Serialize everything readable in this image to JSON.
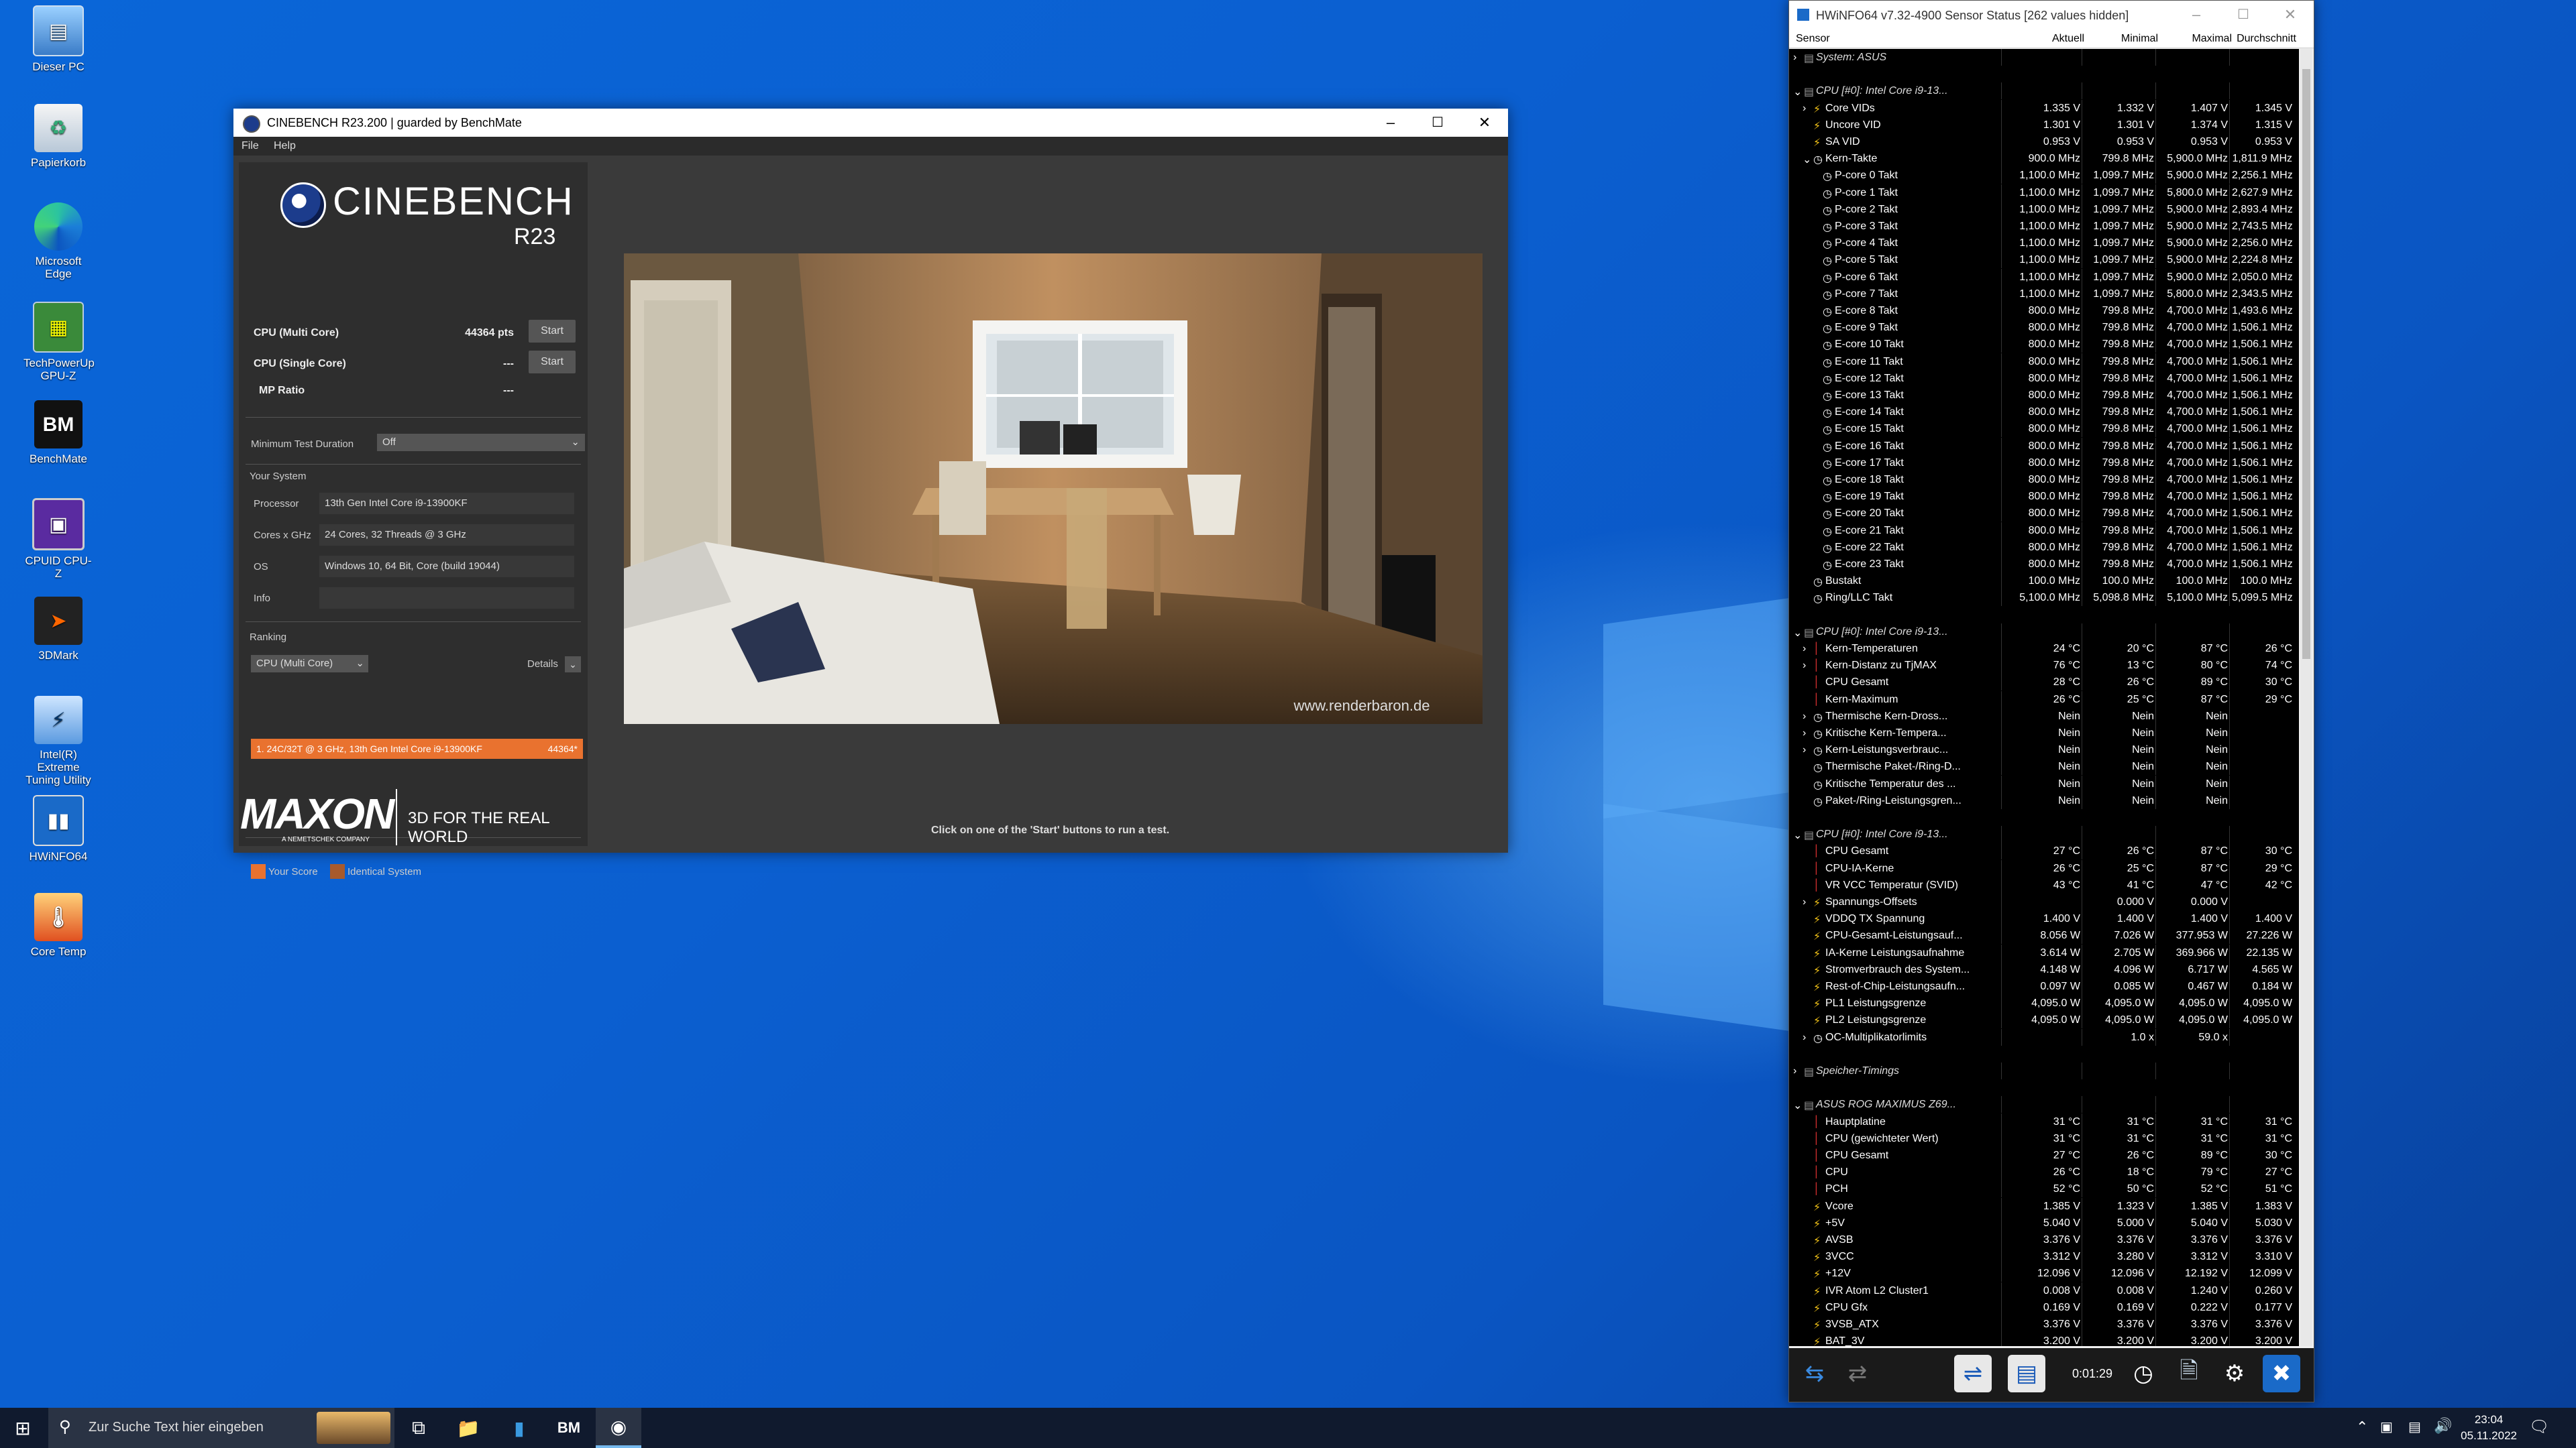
{
  "desktop": {
    "icons": [
      {
        "label": "Dieser PC",
        "icon": "computer-icon"
      },
      {
        "label": "Papierkorb",
        "icon": "recycle-bin-icon"
      },
      {
        "label": "Microsoft Edge",
        "icon": "edge-icon"
      },
      {
        "label": "TechPowerUp GPU-Z",
        "icon": "gpuz-icon"
      },
      {
        "label": "BenchMate",
        "icon": "benchmate-icon"
      },
      {
        "label": "CPUID CPU-Z",
        "icon": "cpuz-icon"
      },
      {
        "label": "3DMark",
        "icon": "3dmark-icon"
      },
      {
        "label": "Intel(R) Extreme Tuning Utility",
        "icon": "xtu-icon"
      },
      {
        "label": "HWiNFO64",
        "icon": "hwinfo-icon"
      },
      {
        "label": "Core Temp",
        "icon": "coretemp-icon"
      }
    ]
  },
  "cinebench": {
    "window_title": "CINEBENCH R23.200 | guarded by BenchMate",
    "menu": [
      "File",
      "Help"
    ],
    "logo_text": "CINEBENCH",
    "logo_version": "R23",
    "tests": [
      {
        "label": "CPU (Multi Core)",
        "value": "44364 pts",
        "button": "Start"
      },
      {
        "label": "CPU (Single Core)",
        "value": "---",
        "button": "Start"
      },
      {
        "label": "MP Ratio",
        "value": "---"
      }
    ],
    "min_duration_label": "Minimum Test Duration",
    "min_duration_value": "Off",
    "your_system_label": "Your System",
    "system": [
      {
        "label": "Processor",
        "value": "13th Gen Intel Core i9-13900KF"
      },
      {
        "label": "Cores x GHz",
        "value": "24 Cores, 32 Threads @ 3 GHz"
      },
      {
        "label": "OS",
        "value": "Windows 10, 64 Bit, Core (build 19044)"
      },
      {
        "label": "Info",
        "value": ""
      }
    ],
    "ranking_label": "Ranking",
    "ranking_select": "CPU (Multi Core)",
    "details_label": "Details",
    "rank_entry": "1. 24C/32T @ 3 GHz, 13th Gen Intel Core i9-13900KF",
    "rank_score": "44364*",
    "legend_your": "Your Score",
    "legend_identical": "Identical System",
    "maxon_text": "MAXON",
    "maxon_sub": "A NEMETSCHEK COMPANY",
    "tagline": "3D FOR THE REAL WORLD",
    "status": "Click on one of the 'Start' buttons to run a test.",
    "watermark": "www.renderbaron.de",
    "colors": {
      "accent": "#e9722f",
      "identical": "#a85a2c"
    }
  },
  "hwinfo": {
    "window_title": "HWiNFO64 v7.32-4900 Sensor Status [262 values hidden]",
    "columns": [
      "Sensor",
      "Aktuell",
      "Minimal",
      "Maximal",
      "Durchschnitt"
    ],
    "time": "0:01:29",
    "rows": [
      {
        "t": "group",
        "name": "System: ASUS",
        "exp": ">"
      },
      {
        "t": "spacer"
      },
      {
        "t": "group",
        "name": "CPU [#0]: Intel Core i9-13...",
        "exp": "v"
      },
      {
        "t": "row",
        "name": "Core VIDs",
        "exp": ">",
        "icon": "bolt",
        "v": [
          "1.335 V",
          "1.332 V",
          "1.407 V",
          "1.345 V"
        ]
      },
      {
        "t": "row",
        "name": "Uncore VID",
        "icon": "bolt",
        "v": [
          "1.301 V",
          "1.301 V",
          "1.374 V",
          "1.315 V"
        ]
      },
      {
        "t": "row",
        "name": "SA VID",
        "icon": "bolt",
        "v": [
          "0.953 V",
          "0.953 V",
          "0.953 V",
          "0.953 V"
        ]
      },
      {
        "t": "row",
        "name": "Kern-Takte",
        "exp": "v",
        "icon": "clock",
        "v": [
          "900.0 MHz",
          "799.8 MHz",
          "5,900.0 MHz",
          "1,811.9 MHz"
        ]
      },
      {
        "t": "row",
        "name": "P-core 0 Takt",
        "icon": "clock",
        "sub": 1,
        "v": [
          "1,100.0 MHz",
          "1,099.7 MHz",
          "5,900.0 MHz",
          "2,256.1 MHz"
        ]
      },
      {
        "t": "row",
        "name": "P-core 1 Takt",
        "icon": "clock",
        "sub": 1,
        "v": [
          "1,100.0 MHz",
          "1,099.7 MHz",
          "5,800.0 MHz",
          "2,627.9 MHz"
        ]
      },
      {
        "t": "row",
        "name": "P-core 2 Takt",
        "icon": "clock",
        "sub": 1,
        "v": [
          "1,100.0 MHz",
          "1,099.7 MHz",
          "5,900.0 MHz",
          "2,893.4 MHz"
        ]
      },
      {
        "t": "row",
        "name": "P-core 3 Takt",
        "icon": "clock",
        "sub": 1,
        "v": [
          "1,100.0 MHz",
          "1,099.7 MHz",
          "5,900.0 MHz",
          "2,743.5 MHz"
        ]
      },
      {
        "t": "row",
        "name": "P-core 4 Takt",
        "icon": "clock",
        "sub": 1,
        "v": [
          "1,100.0 MHz",
          "1,099.7 MHz",
          "5,900.0 MHz",
          "2,256.0 MHz"
        ]
      },
      {
        "t": "row",
        "name": "P-core 5 Takt",
        "icon": "clock",
        "sub": 1,
        "v": [
          "1,100.0 MHz",
          "1,099.7 MHz",
          "5,900.0 MHz",
          "2,224.8 MHz"
        ]
      },
      {
        "t": "row",
        "name": "P-core 6 Takt",
        "icon": "clock",
        "sub": 1,
        "v": [
          "1,100.0 MHz",
          "1,099.7 MHz",
          "5,900.0 MHz",
          "2,050.0 MHz"
        ]
      },
      {
        "t": "row",
        "name": "P-core 7 Takt",
        "icon": "clock",
        "sub": 1,
        "v": [
          "1,100.0 MHz",
          "1,099.7 MHz",
          "5,800.0 MHz",
          "2,343.5 MHz"
        ]
      },
      {
        "t": "row",
        "name": "E-core 8 Takt",
        "icon": "clock",
        "sub": 1,
        "v": [
          "800.0 MHz",
          "799.8 MHz",
          "4,700.0 MHz",
          "1,493.6 MHz"
        ]
      },
      {
        "t": "row",
        "name": "E-core 9 Takt",
        "icon": "clock",
        "sub": 1,
        "v": [
          "800.0 MHz",
          "799.8 MHz",
          "4,700.0 MHz",
          "1,506.1 MHz"
        ]
      },
      {
        "t": "row",
        "name": "E-core 10 Takt",
        "icon": "clock",
        "sub": 1,
        "v": [
          "800.0 MHz",
          "799.8 MHz",
          "4,700.0 MHz",
          "1,506.1 MHz"
        ]
      },
      {
        "t": "row",
        "name": "E-core 11 Takt",
        "icon": "clock",
        "sub": 1,
        "v": [
          "800.0 MHz",
          "799.8 MHz",
          "4,700.0 MHz",
          "1,506.1 MHz"
        ]
      },
      {
        "t": "row",
        "name": "E-core 12 Takt",
        "icon": "clock",
        "sub": 1,
        "v": [
          "800.0 MHz",
          "799.8 MHz",
          "4,700.0 MHz",
          "1,506.1 MHz"
        ]
      },
      {
        "t": "row",
        "name": "E-core 13 Takt",
        "icon": "clock",
        "sub": 1,
        "v": [
          "800.0 MHz",
          "799.8 MHz",
          "4,700.0 MHz",
          "1,506.1 MHz"
        ]
      },
      {
        "t": "row",
        "name": "E-core 14 Takt",
        "icon": "clock",
        "sub": 1,
        "v": [
          "800.0 MHz",
          "799.8 MHz",
          "4,700.0 MHz",
          "1,506.1 MHz"
        ]
      },
      {
        "t": "row",
        "name": "E-core 15 Takt",
        "icon": "clock",
        "sub": 1,
        "v": [
          "800.0 MHz",
          "799.8 MHz",
          "4,700.0 MHz",
          "1,506.1 MHz"
        ]
      },
      {
        "t": "row",
        "name": "E-core 16 Takt",
        "icon": "clock",
        "sub": 1,
        "v": [
          "800.0 MHz",
          "799.8 MHz",
          "4,700.0 MHz",
          "1,506.1 MHz"
        ]
      },
      {
        "t": "row",
        "name": "E-core 17 Takt",
        "icon": "clock",
        "sub": 1,
        "v": [
          "800.0 MHz",
          "799.8 MHz",
          "4,700.0 MHz",
          "1,506.1 MHz"
        ]
      },
      {
        "t": "row",
        "name": "E-core 18 Takt",
        "icon": "clock",
        "sub": 1,
        "v": [
          "800.0 MHz",
          "799.8 MHz",
          "4,700.0 MHz",
          "1,506.1 MHz"
        ]
      },
      {
        "t": "row",
        "name": "E-core 19 Takt",
        "icon": "clock",
        "sub": 1,
        "v": [
          "800.0 MHz",
          "799.8 MHz",
          "4,700.0 MHz",
          "1,506.1 MHz"
        ]
      },
      {
        "t": "row",
        "name": "E-core 20 Takt",
        "icon": "clock",
        "sub": 1,
        "v": [
          "800.0 MHz",
          "799.8 MHz",
          "4,700.0 MHz",
          "1,506.1 MHz"
        ]
      },
      {
        "t": "row",
        "name": "E-core 21 Takt",
        "icon": "clock",
        "sub": 1,
        "v": [
          "800.0 MHz",
          "799.8 MHz",
          "4,700.0 MHz",
          "1,506.1 MHz"
        ]
      },
      {
        "t": "row",
        "name": "E-core 22 Takt",
        "icon": "clock",
        "sub": 1,
        "v": [
          "800.0 MHz",
          "799.8 MHz",
          "4,700.0 MHz",
          "1,506.1 MHz"
        ]
      },
      {
        "t": "row",
        "name": "E-core 23 Takt",
        "icon": "clock",
        "sub": 1,
        "v": [
          "800.0 MHz",
          "799.8 MHz",
          "4,700.0 MHz",
          "1,506.1 MHz"
        ]
      },
      {
        "t": "row",
        "name": "Bustakt",
        "icon": "clock",
        "v": [
          "100.0 MHz",
          "100.0 MHz",
          "100.0 MHz",
          "100.0 MHz"
        ]
      },
      {
        "t": "row",
        "name": "Ring/LLC Takt",
        "icon": "clock",
        "v": [
          "5,100.0 MHz",
          "5,098.8 MHz",
          "5,100.0 MHz",
          "5,099.5 MHz"
        ]
      },
      {
        "t": "spacer"
      },
      {
        "t": "group",
        "name": "CPU [#0]: Intel Core i9-13...",
        "exp": "v"
      },
      {
        "t": "row",
        "name": "Kern-Temperaturen",
        "exp": ">",
        "icon": "temp",
        "v": [
          "24 °C",
          "20 °C",
          "87 °C",
          "26 °C"
        ]
      },
      {
        "t": "row",
        "name": "Kern-Distanz zu TjMAX",
        "exp": ">",
        "icon": "temp",
        "v": [
          "76 °C",
          "13 °C",
          "80 °C",
          "74 °C"
        ]
      },
      {
        "t": "row",
        "name": "CPU Gesamt",
        "icon": "temp",
        "v": [
          "28 °C",
          "26 °C",
          "89 °C",
          "30 °C"
        ]
      },
      {
        "t": "row",
        "name": "Kern-Maximum",
        "icon": "temp",
        "v": [
          "26 °C",
          "25 °C",
          "87 °C",
          "29 °C"
        ]
      },
      {
        "t": "row",
        "name": "Thermische Kern-Dross...",
        "exp": ">",
        "icon": "clock",
        "v": [
          "Nein",
          "Nein",
          "Nein",
          ""
        ]
      },
      {
        "t": "row",
        "name": "Kritische Kern-Tempera...",
        "exp": ">",
        "icon": "clock",
        "v": [
          "Nein",
          "Nein",
          "Nein",
          ""
        ]
      },
      {
        "t": "row",
        "name": "Kern-Leistungsverbrauc...",
        "exp": ">",
        "icon": "clock",
        "v": [
          "Nein",
          "Nein",
          "Nein",
          ""
        ]
      },
      {
        "t": "row",
        "name": "Thermische Paket-/Ring-D...",
        "icon": "clock",
        "v": [
          "Nein",
          "Nein",
          "Nein",
          ""
        ]
      },
      {
        "t": "row",
        "name": "Kritische Temperatur des ...",
        "icon": "clock",
        "v": [
          "Nein",
          "Nein",
          "Nein",
          ""
        ]
      },
      {
        "t": "row",
        "name": "Paket-/Ring-Leistungsgren...",
        "icon": "clock",
        "v": [
          "Nein",
          "Nein",
          "Nein",
          ""
        ]
      },
      {
        "t": "spacer"
      },
      {
        "t": "group",
        "name": "CPU [#0]: Intel Core i9-13...",
        "exp": "v"
      },
      {
        "t": "row",
        "name": "CPU Gesamt",
        "icon": "temp",
        "v": [
          "27 °C",
          "26 °C",
          "87 °C",
          "30 °C"
        ]
      },
      {
        "t": "row",
        "name": "CPU-IA-Kerne",
        "icon": "temp",
        "v": [
          "26 °C",
          "25 °C",
          "87 °C",
          "29 °C"
        ]
      },
      {
        "t": "row",
        "name": "VR VCC Temperatur (SVID)",
        "icon": "temp",
        "v": [
          "43 °C",
          "41 °C",
          "47 °C",
          "42 °C"
        ]
      },
      {
        "t": "row",
        "name": "Spannungs-Offsets",
        "exp": ">",
        "icon": "bolt",
        "v": [
          "",
          "0.000 V",
          "0.000 V",
          ""
        ]
      },
      {
        "t": "row",
        "name": "VDDQ TX Spannung",
        "icon": "bolt",
        "v": [
          "1.400 V",
          "1.400 V",
          "1.400 V",
          "1.400 V"
        ]
      },
      {
        "t": "row",
        "name": "CPU-Gesamt-Leistungsauf...",
        "icon": "bolt",
        "v": [
          "8.056 W",
          "7.026 W",
          "377.953 W",
          "27.226 W"
        ]
      },
      {
        "t": "row",
        "name": "IA-Kerne Leistungsaufnahme",
        "icon": "bolt",
        "v": [
          "3.614 W",
          "2.705 W",
          "369.966 W",
          "22.135 W"
        ]
      },
      {
        "t": "row",
        "name": "Stromverbrauch des System...",
        "icon": "bolt",
        "v": [
          "4.148 W",
          "4.096 W",
          "6.717 W",
          "4.565 W"
        ]
      },
      {
        "t": "row",
        "name": "Rest-of-Chip-Leistungsaufn...",
        "icon": "bolt",
        "v": [
          "0.097 W",
          "0.085 W",
          "0.467 W",
          "0.184 W"
        ]
      },
      {
        "t": "row",
        "name": "PL1 Leistungsgrenze",
        "icon": "bolt",
        "v": [
          "4,095.0 W",
          "4,095.0 W",
          "4,095.0 W",
          "4,095.0 W"
        ]
      },
      {
        "t": "row",
        "name": "PL2 Leistungsgrenze",
        "icon": "bolt",
        "v": [
          "4,095.0 W",
          "4,095.0 W",
          "4,095.0 W",
          "4,095.0 W"
        ]
      },
      {
        "t": "row",
        "name": "OC-Multiplikatorlimits",
        "exp": ">",
        "icon": "clock",
        "v": [
          "",
          "1.0 x",
          "59.0 x",
          ""
        ]
      },
      {
        "t": "spacer"
      },
      {
        "t": "group",
        "name": "Speicher-Timings",
        "exp": ">"
      },
      {
        "t": "spacer"
      },
      {
        "t": "group",
        "name": "ASUS ROG MAXIMUS Z69...",
        "exp": "v"
      },
      {
        "t": "row",
        "name": "Hauptplatine",
        "icon": "temp",
        "v": [
          "31 °C",
          "31 °C",
          "31 °C",
          "31 °C"
        ]
      },
      {
        "t": "row",
        "name": "CPU (gewichteter Wert)",
        "icon": "temp",
        "v": [
          "31 °C",
          "31 °C",
          "31 °C",
          "31 °C"
        ]
      },
      {
        "t": "row",
        "name": "CPU Gesamt",
        "icon": "temp",
        "v": [
          "27 °C",
          "26 °C",
          "89 °C",
          "30 °C"
        ]
      },
      {
        "t": "row",
        "name": "CPU",
        "icon": "temp",
        "v": [
          "26 °C",
          "18 °C",
          "79 °C",
          "27 °C"
        ]
      },
      {
        "t": "row",
        "name": "PCH",
        "icon": "temp",
        "v": [
          "52 °C",
          "50 °C",
          "52 °C",
          "51 °C"
        ]
      },
      {
        "t": "row",
        "name": "Vcore",
        "icon": "bolt",
        "v": [
          "1.385 V",
          "1.323 V",
          "1.385 V",
          "1.383 V"
        ]
      },
      {
        "t": "row",
        "name": "+5V",
        "icon": "bolt",
        "v": [
          "5.040 V",
          "5.000 V",
          "5.040 V",
          "5.030 V"
        ]
      },
      {
        "t": "row",
        "name": "AVSB",
        "icon": "bolt",
        "v": [
          "3.376 V",
          "3.376 V",
          "3.376 V",
          "3.376 V"
        ]
      },
      {
        "t": "row",
        "name": "3VCC",
        "icon": "bolt",
        "v": [
          "3.312 V",
          "3.280 V",
          "3.312 V",
          "3.310 V"
        ]
      },
      {
        "t": "row",
        "name": "+12V",
        "icon": "bolt",
        "v": [
          "12.096 V",
          "12.096 V",
          "12.192 V",
          "12.099 V"
        ]
      },
      {
        "t": "row",
        "name": "IVR Atom L2 Cluster1",
        "icon": "bolt",
        "v": [
          "0.008 V",
          "0.008 V",
          "1.240 V",
          "0.260 V"
        ]
      },
      {
        "t": "row",
        "name": "CPU Gfx",
        "icon": "bolt",
        "v": [
          "0.169 V",
          "0.169 V",
          "0.222 V",
          "0.177 V"
        ]
      },
      {
        "t": "row",
        "name": "3VSB_ATX",
        "icon": "bolt",
        "v": [
          "3.376 V",
          "3.376 V",
          "3.376 V",
          "3.376 V"
        ]
      },
      {
        "t": "row",
        "name": "BAT_3V",
        "icon": "bolt",
        "v": [
          "3.200 V",
          "3.200 V",
          "3.200 V",
          "3.200 V"
        ]
      }
    ]
  },
  "taskbar": {
    "search_placeholder": "Zur Suche Text hier eingeben",
    "time": "23:04",
    "date": "05.11.2022"
  }
}
